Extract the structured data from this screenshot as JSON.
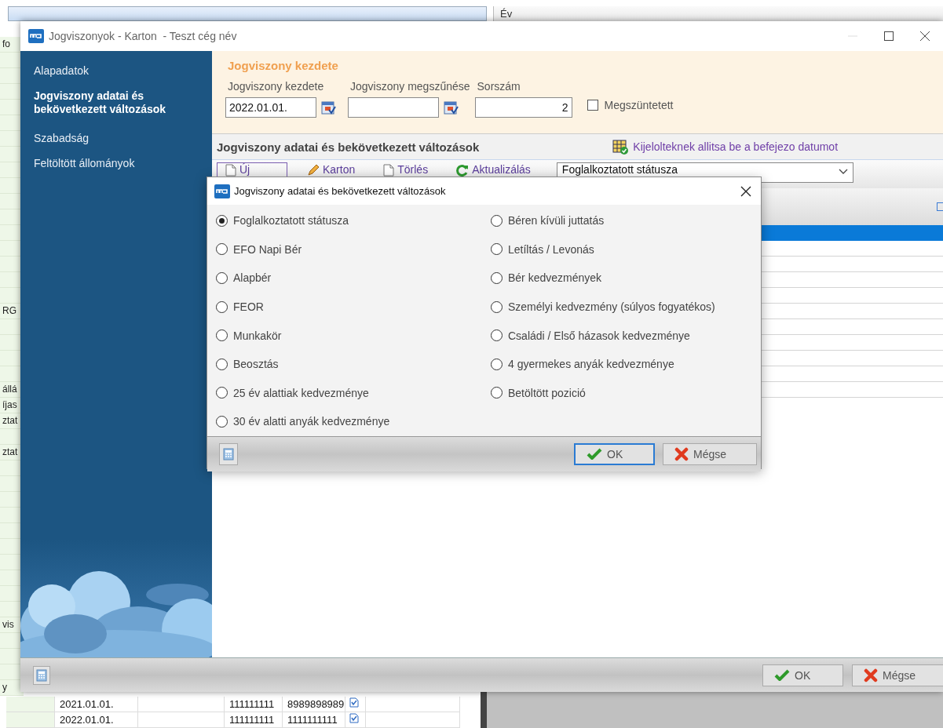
{
  "background": {
    "column_header": "Év",
    "side_rows": [
      {
        "kind": "text",
        "text": "fo"
      },
      {
        "kind": "blank"
      },
      {
        "kind": "blank"
      },
      {
        "kind": "blank"
      },
      {
        "kind": "blank"
      },
      {
        "kind": "blank"
      },
      {
        "kind": "blank"
      },
      {
        "kind": "blank"
      },
      {
        "kind": "blank"
      },
      {
        "kind": "blank"
      },
      {
        "kind": "blank"
      },
      {
        "kind": "blank"
      },
      {
        "kind": "blank"
      },
      {
        "kind": "blank"
      },
      {
        "kind": "blank"
      },
      {
        "kind": "blank"
      },
      {
        "kind": "blank"
      },
      {
        "kind": "text",
        "text": "RG"
      },
      {
        "kind": "blank"
      },
      {
        "kind": "blank"
      },
      {
        "kind": "blank"
      },
      {
        "kind": "blank"
      },
      {
        "kind": "text",
        "text": "állá"
      },
      {
        "kind": "text",
        "text": "íjas"
      },
      {
        "kind": "text",
        "text": "ztat"
      },
      {
        "kind": "blank"
      },
      {
        "kind": "text",
        "text": "ztat"
      },
      {
        "kind": "blank"
      },
      {
        "kind": "blank"
      },
      {
        "kind": "blank"
      },
      {
        "kind": "blank"
      },
      {
        "kind": "blank"
      },
      {
        "kind": "blank"
      },
      {
        "kind": "blank"
      },
      {
        "kind": "blank"
      },
      {
        "kind": "blank"
      },
      {
        "kind": "blank"
      },
      {
        "kind": "text",
        "text": "vis"
      },
      {
        "kind": "blank"
      },
      {
        "kind": "blank"
      },
      {
        "kind": "blank"
      },
      {
        "kind": "text",
        "text": "y"
      }
    ],
    "rows": [
      {
        "cells": [
          "2021.01.01.",
          "111111111",
          "8989898989"
        ]
      },
      {
        "cells": [
          "2022.01.01.",
          "111111111",
          "1111111111"
        ]
      }
    ]
  },
  "window": {
    "title": "Jogviszonyok - Karton  - Teszt cég név",
    "sidebar": {
      "items": [
        {
          "label": "Alapadatok",
          "selected": false
        },
        {
          "label": "Jogviszony adatai és bekövetkezett változások",
          "selected": true
        },
        {
          "label": "Szabadság",
          "selected": false
        },
        {
          "label": "Feltöltött állományok",
          "selected": false
        }
      ]
    },
    "start_panel": {
      "title": "Jogviszony kezdete",
      "fields": [
        {
          "kind": "date",
          "label": "Jogviszony kezdete",
          "value": "2022.01.01."
        },
        {
          "kind": "date",
          "label": "Jogviszony megszűnése"
        },
        {
          "kind": "number",
          "label": "Sorszám",
          "value": "2"
        }
      ],
      "checkbox": {
        "label": "Megszüntetett",
        "checked": false
      }
    },
    "section": {
      "title": "Jogviszony adatai és bekövetkezett változások",
      "link": "Kijelolteknek allitsa be a befejezo datumot"
    },
    "toolbar": {
      "buttons": [
        {
          "kind": "new",
          "label": "Új",
          "focused": true
        },
        {
          "kind": "edit",
          "label": "Karton",
          "focused": false
        },
        {
          "kind": "delete",
          "label": "Törlés",
          "focused": false
        },
        {
          "kind": "refresh",
          "label": "Aktualizálás",
          "focused": false
        }
      ],
      "dropdown": {
        "value": "Foglalkoztatott státusza"
      }
    },
    "table": {
      "rows": [
        {
          "selected": true
        },
        {
          "selected": false
        },
        {
          "selected": false
        },
        {
          "selected": false
        },
        {
          "selected": false
        },
        {
          "selected": false
        },
        {
          "selected": false
        },
        {
          "selected": false
        },
        {
          "selected": false
        },
        {
          "selected": false
        },
        {
          "selected": false
        }
      ]
    },
    "footer": {
      "buttons": [
        {
          "kind": "ok",
          "label": "OK"
        },
        {
          "kind": "cancel",
          "label": "Mégse"
        }
      ]
    }
  },
  "dialog": {
    "title": "Jogviszony adatai és bekövetkezett változások",
    "columns": [
      [
        {
          "label": "Foglalkoztatott státusza",
          "selected": true
        },
        {
          "label": "EFO Napi Bér",
          "selected": false
        },
        {
          "label": "Alapbér",
          "selected": false
        },
        {
          "label": "FEOR",
          "selected": false
        },
        {
          "label": "Munkakör",
          "selected": false
        },
        {
          "label": "Beosztás",
          "selected": false
        },
        {
          "label": "25 év alattiak kedvezménye",
          "selected": false
        },
        {
          "label": "30 év alatti anyák kedvezménye",
          "selected": false
        }
      ],
      [
        {
          "label": "Béren kívüli juttatás",
          "selected": false
        },
        {
          "label": "Letíltás / Levonás",
          "selected": false
        },
        {
          "label": "Bér kedvezmények",
          "selected": false
        },
        {
          "label": "Személyi kedvezmény (súlyos fogyatékos)",
          "selected": false
        },
        {
          "label": "Családi / Első házasok kedvezménye",
          "selected": false
        },
        {
          "label": "4 gyermekes anyák kedvezménye",
          "selected": false
        },
        {
          "label": "Betöltött pozició",
          "selected": false
        }
      ]
    ],
    "footer": {
      "buttons": [
        {
          "kind": "ok",
          "label": "OK",
          "default": true
        },
        {
          "kind": "cancel",
          "label": "Mégse",
          "default": false
        }
      ]
    }
  }
}
